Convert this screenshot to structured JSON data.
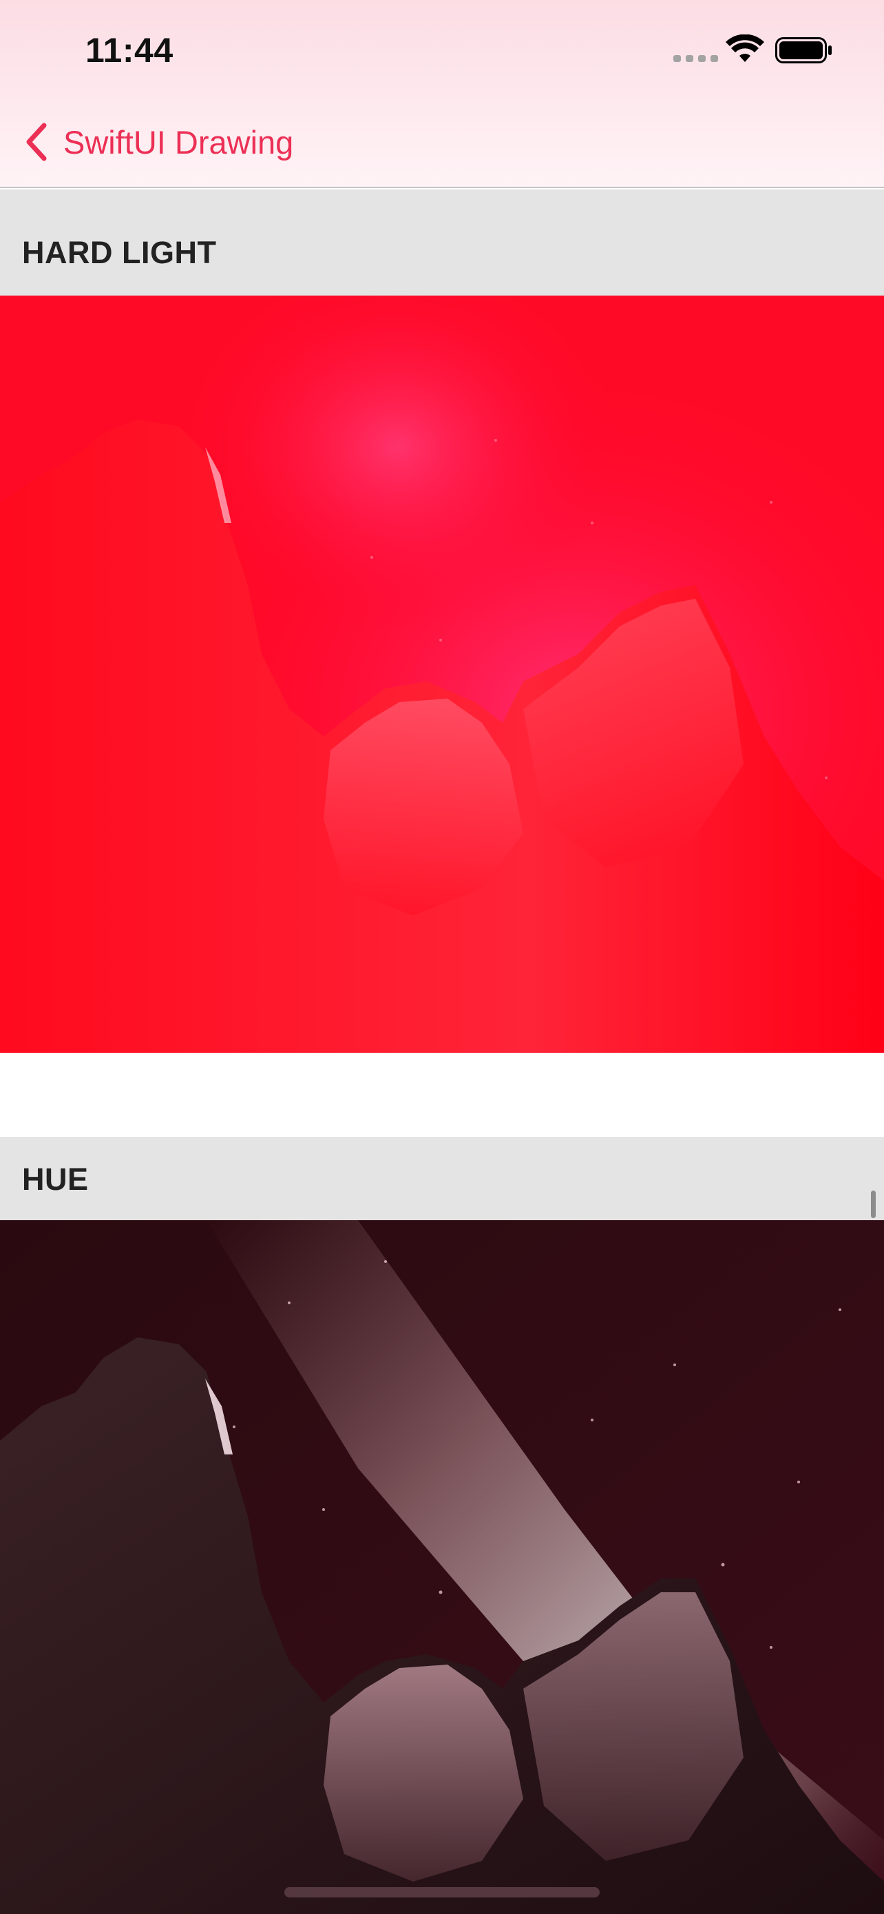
{
  "status_bar": {
    "time": "11:44",
    "icons": [
      "cellular-signal-icon",
      "wifi-icon",
      "battery-icon"
    ]
  },
  "nav": {
    "back_label": "SwiftUI Drawing",
    "accent_color": "#ec2f55"
  },
  "sections": [
    {
      "title": "HARD LIGHT",
      "image": "night-sky-mountains-hard-light-red"
    },
    {
      "title": "HUE",
      "image": "night-sky-mountains-hue-red"
    }
  ]
}
